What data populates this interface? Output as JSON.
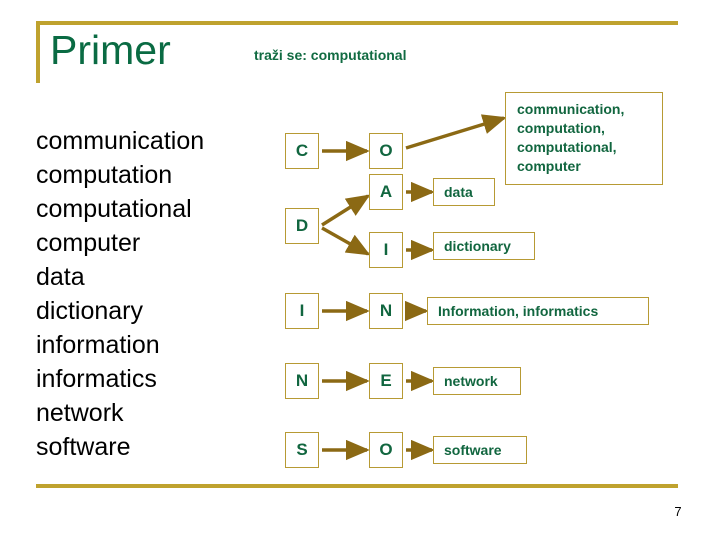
{
  "slide": {
    "title": "Primer",
    "subtitle": "traži se: computational",
    "page_number": "7",
    "colors": {
      "rule_gold": "#BFA22E",
      "box_border_gold": "#B79A34",
      "arrow_gold": "#8B6914",
      "title_green": "#0A6B43",
      "text_green": "#11663F",
      "word_black": "#000000",
      "background": "#FFFFFF"
    }
  },
  "word_list": {
    "words": [
      "communication",
      "computation",
      "computational",
      "computer",
      "data",
      "dictionary",
      "information",
      "informatics",
      "network",
      "software"
    ]
  },
  "diagram": {
    "letters": {
      "c": "C",
      "o_top": "O",
      "d": "D",
      "a": "A",
      "i_mid": "I",
      "i_row": "I",
      "n_row": "N",
      "n_start": "N",
      "e": "E",
      "s": "S",
      "o_bottom": "O"
    },
    "results": {
      "c_o": [
        "communication,",
        "computation,",
        "computational,",
        "computer"
      ],
      "d_a": "data",
      "d_i": "dictionary",
      "i_n": "Information, informatics",
      "n_e": "network",
      "s_o": "software"
    }
  }
}
